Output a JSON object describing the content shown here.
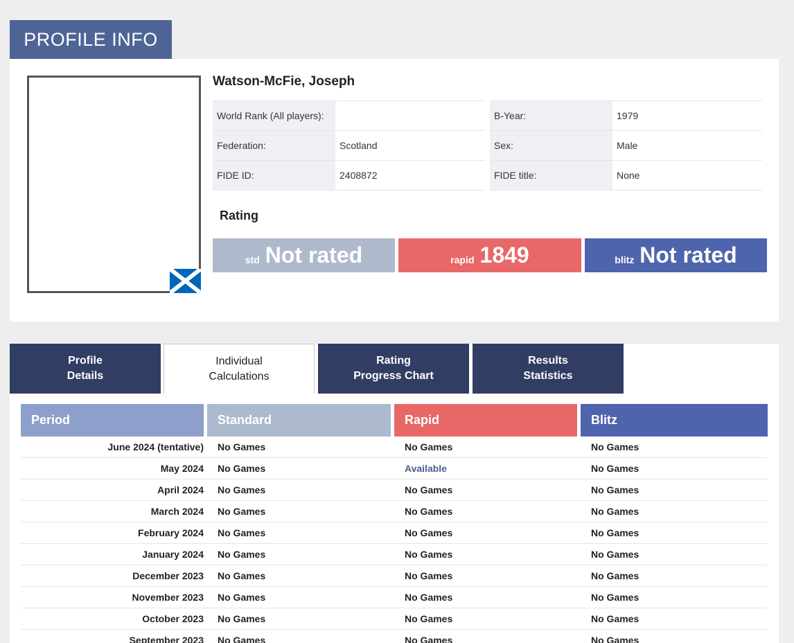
{
  "header": {
    "title": "PROFILE INFO"
  },
  "player": {
    "name": "Watson-McFie, Joseph",
    "flag": "scotland-flag"
  },
  "info_left": [
    {
      "label": "World Rank (All players):",
      "value": ""
    },
    {
      "label": "Federation:",
      "value": "Scotland"
    },
    {
      "label": "FIDE ID:",
      "value": "2408872"
    }
  ],
  "info_right": [
    {
      "label": "B-Year:",
      "value": "1979"
    },
    {
      "label": "Sex:",
      "value": "Male"
    },
    {
      "label": "FIDE title:",
      "value": "None"
    }
  ],
  "rating": {
    "title": "Rating",
    "std": {
      "label": "std",
      "value": "Not rated"
    },
    "rapid": {
      "label": "rapid",
      "value": "1849"
    },
    "blitz": {
      "label": "blitz",
      "value": "Not rated"
    }
  },
  "tabs": [
    {
      "label": "Profile\nDetails"
    },
    {
      "label": "Individual\nCalculations"
    },
    {
      "label": "Rating\nProgress Chart"
    },
    {
      "label": "Results\nStatistics"
    }
  ],
  "table": {
    "headers": {
      "period": "Period",
      "standard": "Standard",
      "rapid": "Rapid",
      "blitz": "Blitz"
    },
    "rows": [
      {
        "period": "June 2024 (tentative)",
        "standard": "No Games",
        "rapid": "No Games",
        "blitz": "No Games"
      },
      {
        "period": "May 2024",
        "standard": "No Games",
        "rapid": "Available",
        "blitz": "No Games"
      },
      {
        "period": "April 2024",
        "standard": "No Games",
        "rapid": "No Games",
        "blitz": "No Games"
      },
      {
        "period": "March 2024",
        "standard": "No Games",
        "rapid": "No Games",
        "blitz": "No Games"
      },
      {
        "period": "February 2024",
        "standard": "No Games",
        "rapid": "No Games",
        "blitz": "No Games"
      },
      {
        "period": "January 2024",
        "standard": "No Games",
        "rapid": "No Games",
        "blitz": "No Games"
      },
      {
        "period": "December 2023",
        "standard": "No Games",
        "rapid": "No Games",
        "blitz": "No Games"
      },
      {
        "period": "November 2023",
        "standard": "No Games",
        "rapid": "No Games",
        "blitz": "No Games"
      },
      {
        "period": "October 2023",
        "standard": "No Games",
        "rapid": "No Games",
        "blitz": "No Games"
      },
      {
        "period": "September 2023",
        "standard": "No Games",
        "rapid": "No Games",
        "blitz": "No Games"
      }
    ]
  },
  "colors": {
    "header_bg": "#4f6496",
    "std": "#aeb9cc",
    "rapid": "#e86868",
    "blitz": "#4e64ad",
    "period": "#8e9fcb",
    "tab": "#323d63"
  }
}
